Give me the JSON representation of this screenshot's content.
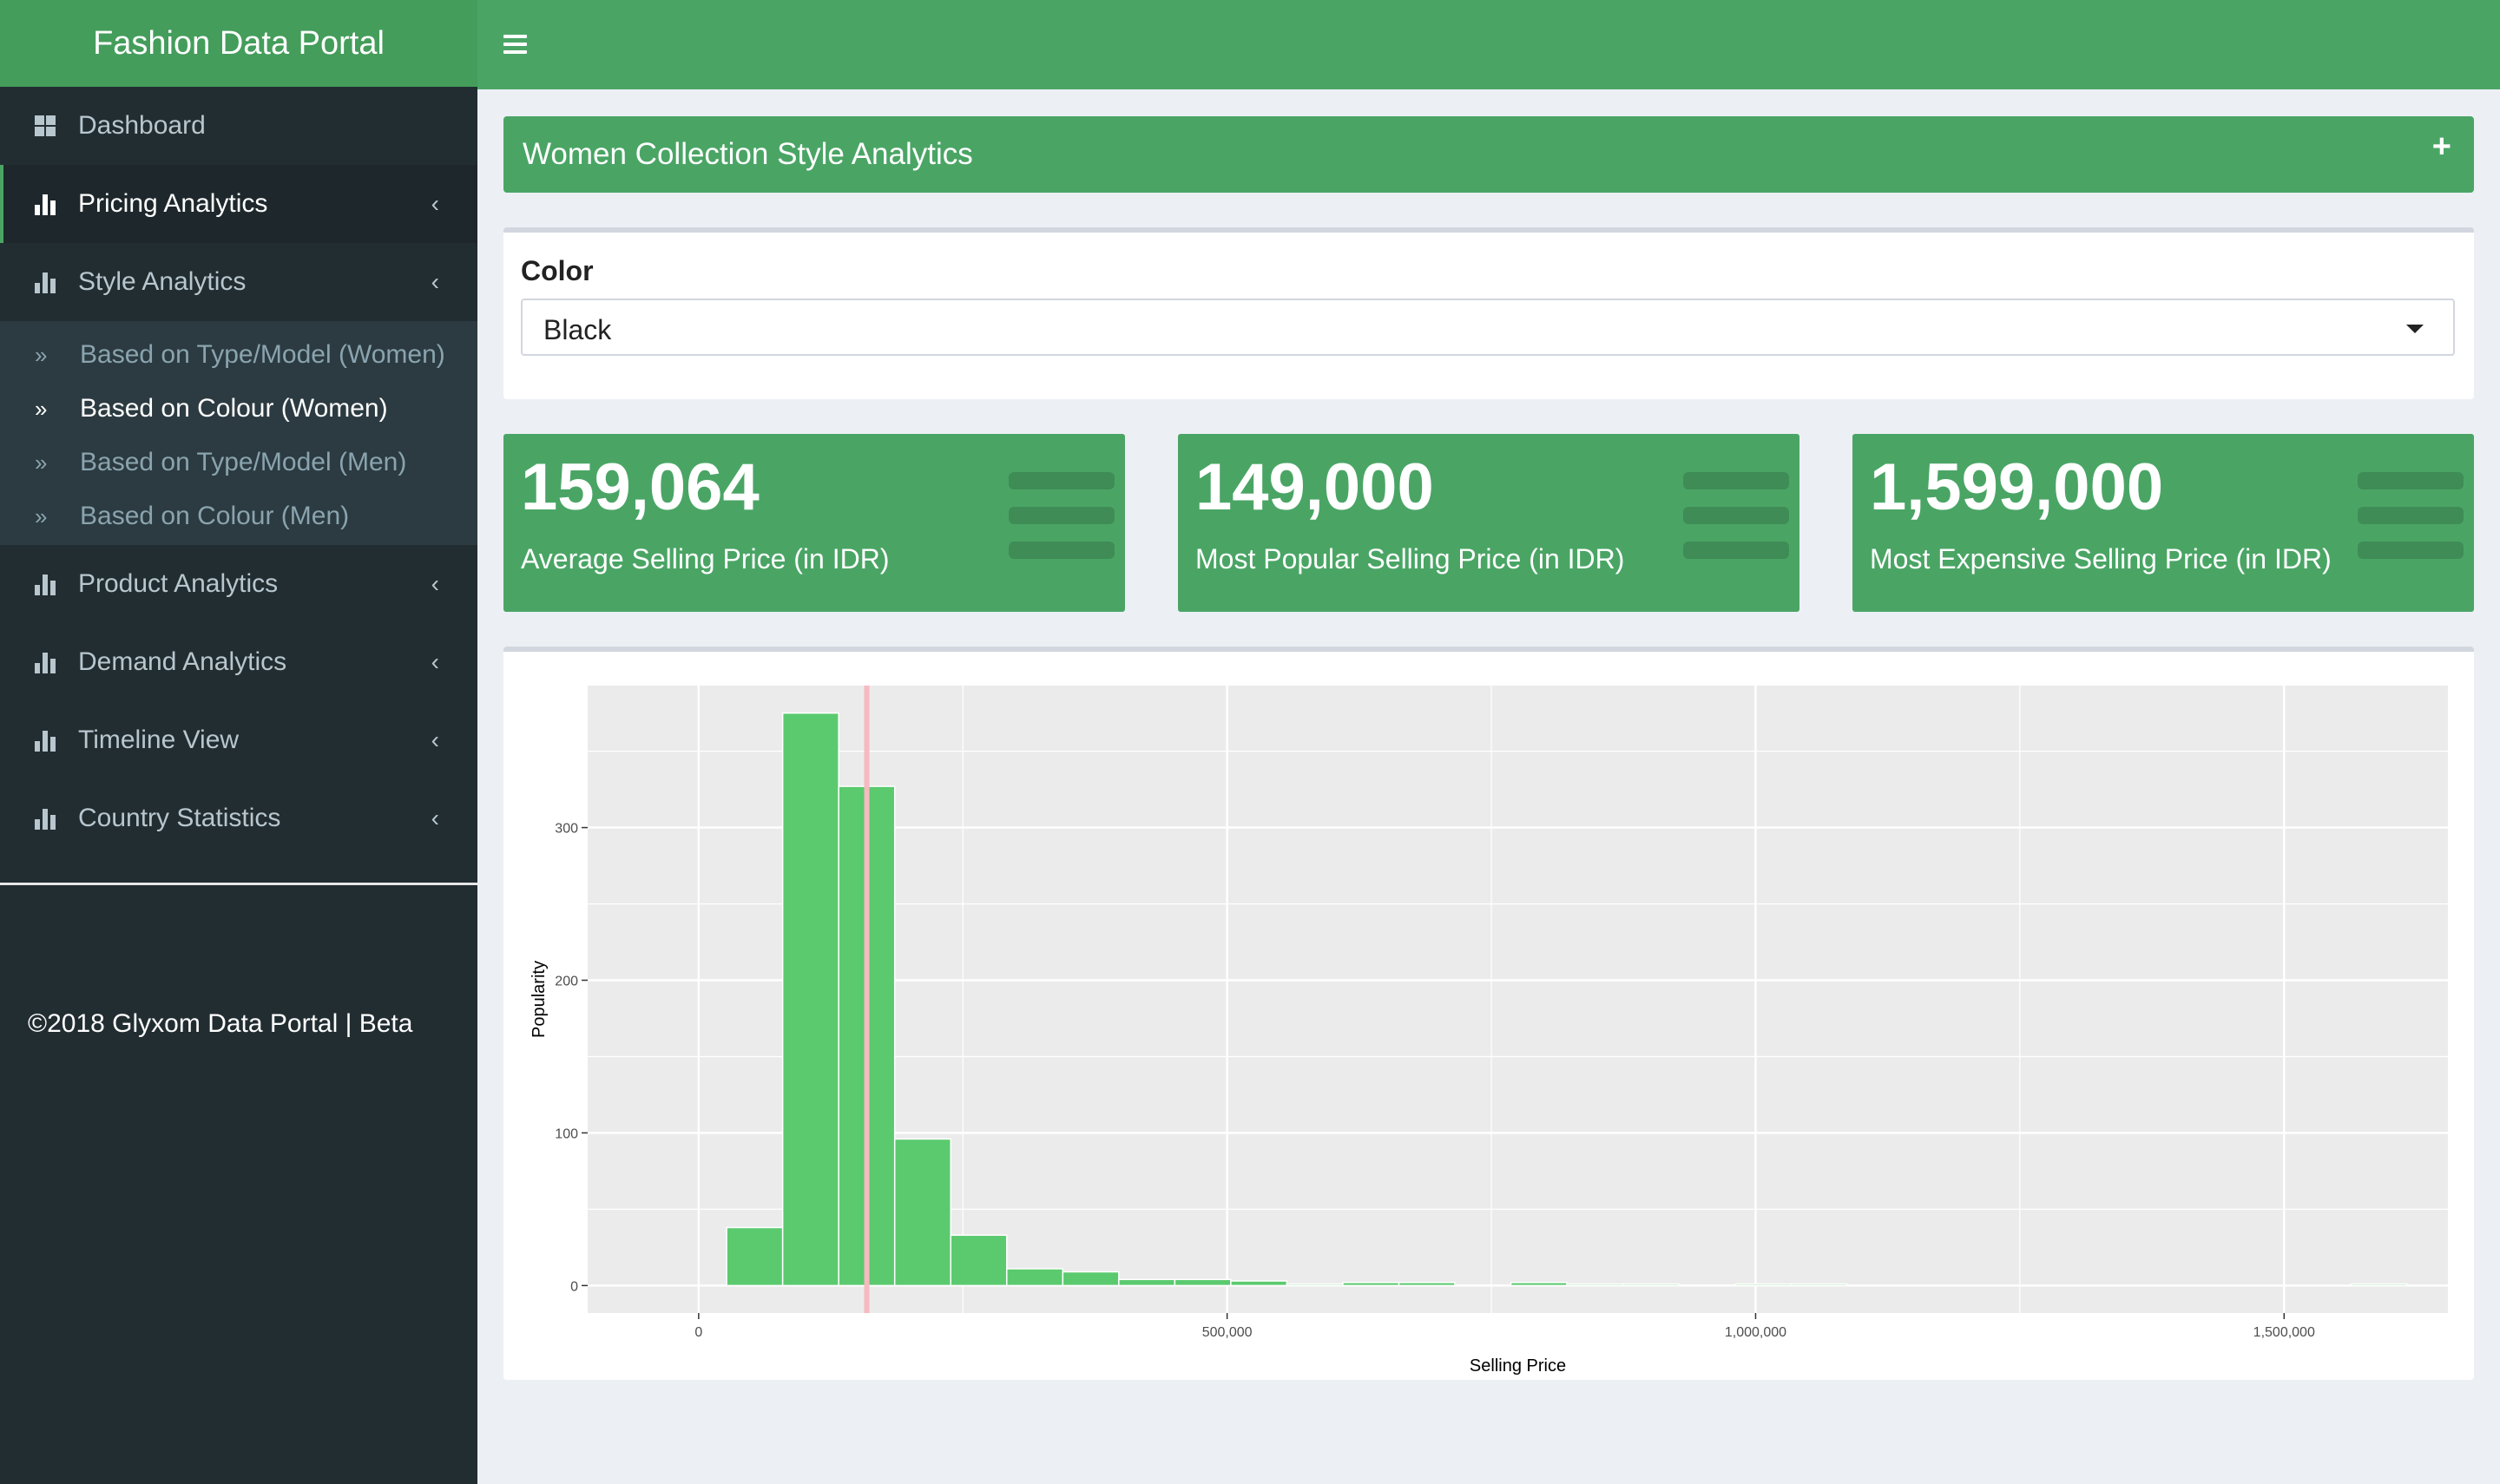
{
  "app": {
    "title": "Fashion Data Portal"
  },
  "sidebar": {
    "items": [
      {
        "label": "Dashboard",
        "icon": "dashboard-icon"
      },
      {
        "label": "Pricing Analytics",
        "icon": "bar-chart-icon",
        "active": true
      },
      {
        "label": "Style Analytics",
        "icon": "bar-chart-icon",
        "open": true
      },
      {
        "label": "Product Analytics",
        "icon": "bar-chart-icon"
      },
      {
        "label": "Demand Analytics",
        "icon": "bar-chart-icon"
      },
      {
        "label": "Timeline View",
        "icon": "bar-chart-icon"
      },
      {
        "label": "Country Statistics",
        "icon": "bar-chart-icon"
      }
    ],
    "style_submenu": [
      {
        "label": "Based on Type/Model (Women)"
      },
      {
        "label": "Based on Colour (Women)",
        "active": true
      },
      {
        "label": "Based on Type/Model (Men)"
      },
      {
        "label": "Based on Colour (Men)"
      }
    ],
    "chevron": "‹",
    "sub_icon": "»",
    "copyright": "©2018 Glyxom Data Portal | Beta"
  },
  "section": {
    "title": "Women Collection Style Analytics",
    "collapse_label": "+"
  },
  "filter": {
    "label": "Color",
    "selected": "Black"
  },
  "value_boxes": [
    {
      "value": "159,064",
      "label": "Average Selling Price (in IDR)",
      "icon": "list-icon"
    },
    {
      "value": "149,000",
      "label": "Most Popular Selling Price (in IDR)",
      "icon": "list-icon"
    },
    {
      "value": "1,599,000",
      "label": "Most Expensive Selling Price (in IDR)",
      "icon": "list-icon"
    }
  ],
  "colors": {
    "accent": "#4aa565",
    "sidebar_bg": "#222d32",
    "bar_fill": "#5bca6f",
    "mean_line": "#f8b9c0",
    "panel_bg": "#ebebeb"
  },
  "chart_data": {
    "type": "bar",
    "xlabel": "Selling Price",
    "ylabel": "Popularity",
    "xlim": [
      -105000,
      1655000
    ],
    "ylim": [
      -18,
      393
    ],
    "bin_width": 53000,
    "bins": [
      {
        "x": 53000,
        "count": 38
      },
      {
        "x": 106000,
        "count": 375
      },
      {
        "x": 159000,
        "count": 327
      },
      {
        "x": 212000,
        "count": 96
      },
      {
        "x": 265000,
        "count": 33
      },
      {
        "x": 318000,
        "count": 11
      },
      {
        "x": 371000,
        "count": 9
      },
      {
        "x": 424000,
        "count": 4
      },
      {
        "x": 477000,
        "count": 4
      },
      {
        "x": 530000,
        "count": 3
      },
      {
        "x": 583000,
        "count": 1
      },
      {
        "x": 636000,
        "count": 2
      },
      {
        "x": 689000,
        "count": 2
      },
      {
        "x": 742000,
        "count": 0
      },
      {
        "x": 795000,
        "count": 2
      },
      {
        "x": 848000,
        "count": 1
      },
      {
        "x": 901000,
        "count": 1
      },
      {
        "x": 954000,
        "count": 0
      },
      {
        "x": 1007000,
        "count": 1
      },
      {
        "x": 1060000,
        "count": 1
      },
      {
        "x": 1590000,
        "count": 1
      }
    ],
    "mean_line": 159064,
    "x_ticks": [
      {
        "value": 0,
        "label": "0"
      },
      {
        "value": 500000,
        "label": "500,000"
      },
      {
        "value": 1000000,
        "label": "1,000,000"
      },
      {
        "value": 1500000,
        "label": "1,500,000"
      }
    ],
    "y_ticks": [
      {
        "value": 0,
        "label": "0"
      },
      {
        "value": 100,
        "label": "100"
      },
      {
        "value": 200,
        "label": "200"
      },
      {
        "value": 300,
        "label": "300"
      }
    ],
    "grid": true
  }
}
